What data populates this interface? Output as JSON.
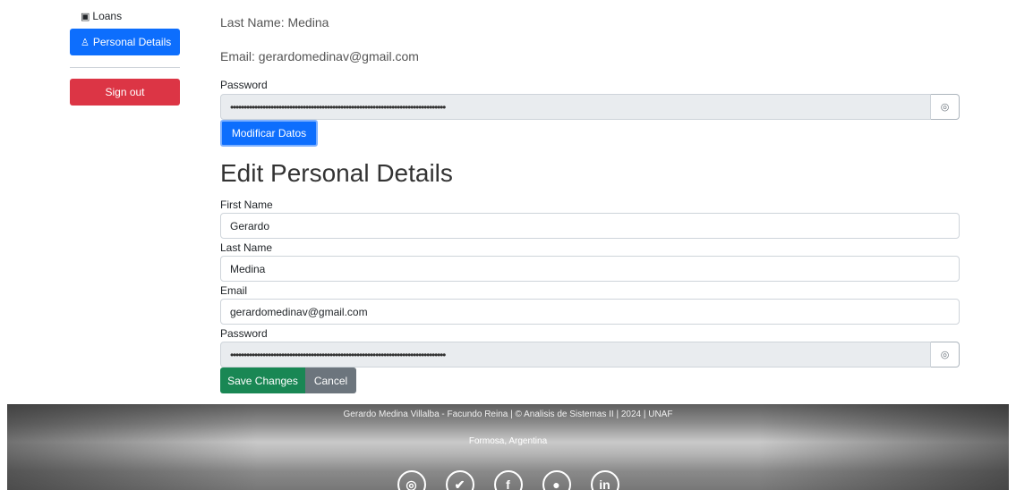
{
  "sidebar": {
    "loans_label": "Loans",
    "loans_icon": "loans-icon",
    "personal_details_label": "Personal Details",
    "personal_details_icon": "user-icon",
    "sign_out_label": "Sign out"
  },
  "profile": {
    "last_name_line": "Last Name: Medina",
    "email_line": "Email: gerardomedinav@gmail.com",
    "password_label": "Password",
    "password_value": "••••••••••••••••••••••••••••••••••••••••••••••••••••••••••••••••••••••••••••••••",
    "modify_button": "Modificar Datos"
  },
  "edit_form": {
    "title": "Edit Personal Details",
    "first_name_label": "First Name",
    "first_name_value": "Gerardo",
    "last_name_label": "Last Name",
    "last_name_value": "Medina",
    "email_label": "Email",
    "email_value": "gerardomedinav@gmail.com",
    "password_label": "Password",
    "password_value": "••••••••••••••••••••••••••••••••••••••••••••••••••••••••••••••••••••••••••••••••",
    "save_button": "Save Changes",
    "cancel_button": "Cancel"
  },
  "footer": {
    "credits": "Gerardo Medina Villalba - Facundo Reina | © Analisis de Sistemas II | 2024 | UNAF",
    "location": "Formosa, Argentina",
    "social_icons": [
      "instagram-icon",
      "twitter-icon",
      "facebook-icon",
      "github-icon",
      "linkedin-icon"
    ]
  },
  "colors": {
    "primary": "#0d6efd",
    "danger": "#dc3545",
    "success": "#198754",
    "secondary": "#6c757d"
  }
}
